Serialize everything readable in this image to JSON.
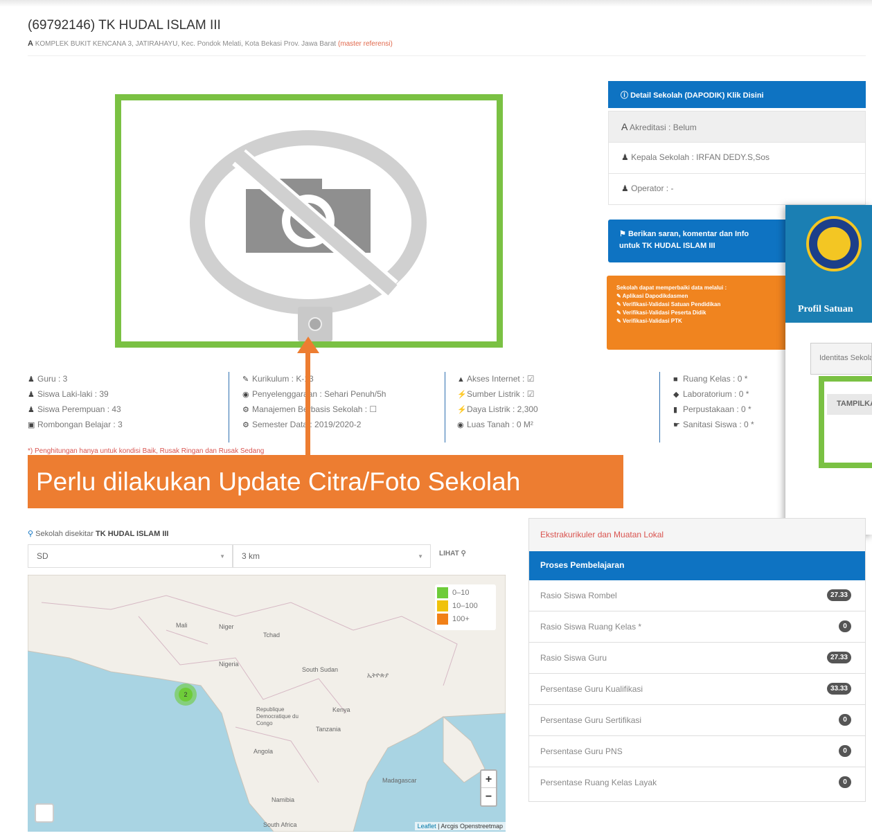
{
  "header": {
    "title": "(69792146) TK HUDAL ISLAM III",
    "address": "KOMPLEK BUKIT KENCANA 3, JATIRAHAYU, Kec. Pondok Melati, Kota Bekasi Prov. Jawa Barat",
    "address_link": "(master referensi)"
  },
  "stats": {
    "col1": [
      "Guru : 3",
      "Siswa Laki-laki : 39",
      "Siswa Perempuan : 43",
      "Rombongan Belajar : 3"
    ],
    "col2": [
      "Kurikulum : K-13",
      "Penyelenggaraan : Sehari Penuh/5h",
      "Manajemen Berbasis Sekolah : ☐",
      "Semester Data : 2019/2020-2"
    ],
    "col3": [
      "Akses Internet : ☑",
      "Sumber Listrik : ☑",
      "Daya Listrik : 2,300",
      "Luas Tanah : 0 M²"
    ],
    "col4": [
      "Ruang Kelas : 0 *",
      "Laboratorium : 0 *",
      "Perpustakaan : 0 *",
      "Sanitasi Siswa : 0 *"
    ],
    "note": "*) Penghitungan hanya untuk kondisi Baik, Rusak Ringan dan Rusak Sedang"
  },
  "banner": {
    "text": "Perlu dilakukan Update Citra/Foto Sekolah"
  },
  "detail": {
    "head": "Detail Sekolah (DAPODIK) Klik Disini",
    "akreditasi": "Akreditasi : Belum",
    "kepala": "Kepala Sekolah : IRFAN DEDY.S,Sos",
    "operator": "Operator : -"
  },
  "saran": {
    "line1": "Berikan saran, komentar dan Info",
    "line2": "untuk TK HUDAL ISLAM III"
  },
  "perbaikan": {
    "title": "Sekolah dapat memperbaiki data melalui :",
    "items": [
      "Aplikasi Dapodikdasmen",
      "Verifikasi-Validasi Satuan Pendidikan",
      "Verifikasi-Validasi Peserta Didik",
      "Verifikasi-Validasi PTK"
    ]
  },
  "popup": {
    "title": "Profil Satuan",
    "tab": "Identitas Sekolah",
    "button": "TAMPILKAN"
  },
  "nearby": {
    "label": "Sekolah disekitar",
    "school": "TK HUDAL ISLAM III",
    "level_value": "SD",
    "radius_value": "3 km",
    "lihat": "LIHAT",
    "legend": [
      "0–10",
      "10–100",
      "100+"
    ],
    "cluster_count": "2",
    "attribution_link": "Leaflet",
    "attribution_rest": " | Arcgis Openstreetmap",
    "map_labels": [
      "Mali",
      "Niger",
      "Tchad",
      "Nigeria",
      "South Sudan",
      "ኢትዮጵያ",
      "Republique Democratique du Congo",
      "Tanzania",
      "Kenya",
      "Angola",
      "Namibia",
      "Madagascar",
      "South Africa"
    ],
    "zoom_in": "+",
    "zoom_out": "−"
  },
  "rasio": {
    "eks": "Ekstrakurikuler dan Muatan Lokal",
    "proses": "Proses Pembelajaran",
    "rows": [
      {
        "label": "Rasio Siswa Rombel",
        "value": "27.33"
      },
      {
        "label": "Rasio Siswa Ruang Kelas *",
        "value": "0"
      },
      {
        "label": "Rasio Siswa Guru",
        "value": "27.33"
      },
      {
        "label": "Persentase Guru Kualifikasi",
        "value": "33.33"
      },
      {
        "label": "Persentase Guru Sertifikasi",
        "value": "0"
      },
      {
        "label": "Persentase Guru PNS",
        "value": "0"
      },
      {
        "label": "Persentase Ruang Kelas Layak",
        "value": "0"
      }
    ]
  },
  "colors": {
    "green_frame": "#7ac143",
    "orange": "#ed7d31",
    "primary_blue": "#0e73c2",
    "badge": "#555555"
  },
  "icons": [
    "info-icon",
    "user-icon",
    "comment-icon",
    "globe-icon",
    "gear-icon",
    "bolt-icon",
    "signal-icon",
    "map-marker-icon",
    "search-icon",
    "no-photo-icon"
  ]
}
